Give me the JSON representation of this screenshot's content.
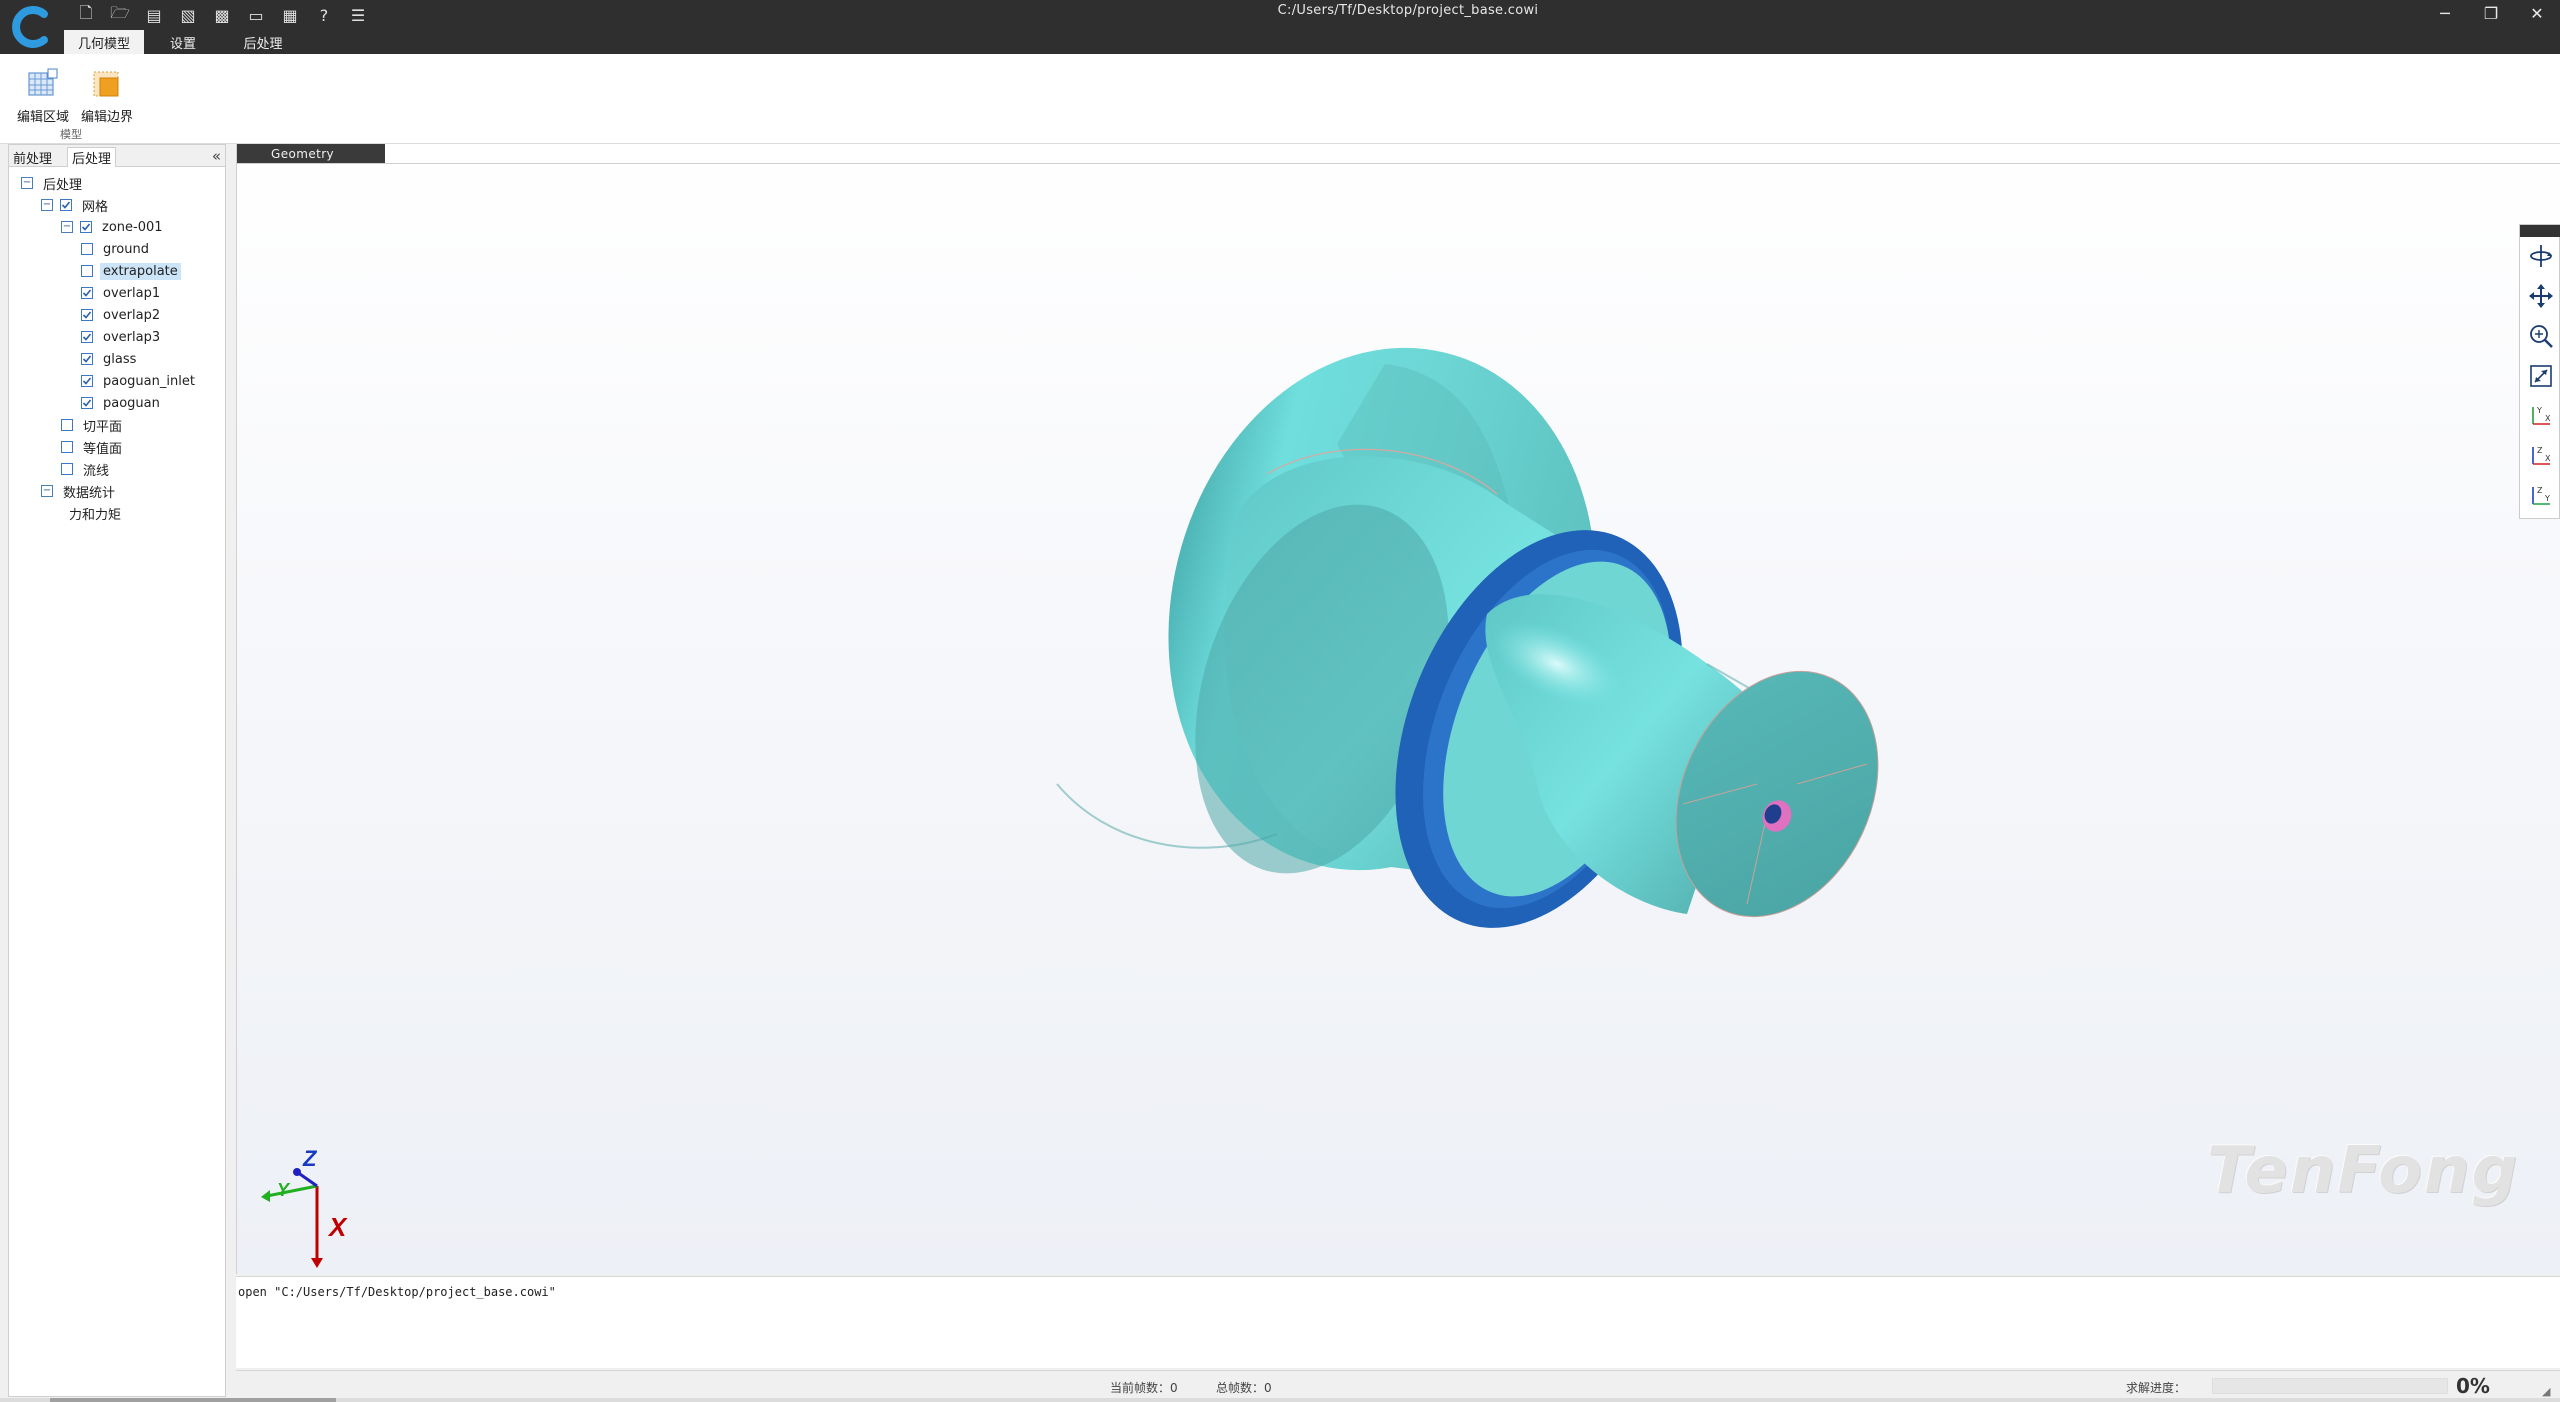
{
  "window": {
    "title": "C:/Users/Tf/Desktop/project_base.cowi",
    "minimize_glyph": "─",
    "restore_glyph": "❐",
    "close_glyph": "✕"
  },
  "quick_access": [
    {
      "name": "new-file-icon",
      "glyph": "🗋"
    },
    {
      "name": "open-folder-icon",
      "glyph": "🗁"
    },
    {
      "name": "import-icon",
      "glyph": "▤"
    },
    {
      "name": "export-icon",
      "glyph": "▧"
    },
    {
      "name": "run-script-icon",
      "glyph": "▩"
    },
    {
      "name": "save-icon",
      "glyph": "▭"
    },
    {
      "name": "save-as-icon",
      "glyph": "▦"
    },
    {
      "name": "help-icon",
      "glyph": "?"
    },
    {
      "name": "document-icon",
      "glyph": "☰"
    }
  ],
  "menu": {
    "tabs": [
      "几何模型",
      "设置",
      "后处理"
    ],
    "active_index": 0
  },
  "ribbon": {
    "buttons": [
      {
        "label": "编辑区域",
        "icon": "edit-region-icon"
      },
      {
        "label": "编辑边界",
        "icon": "edit-boundary-icon"
      }
    ],
    "group_label": "模型"
  },
  "left_panel": {
    "tabs": [
      "前处理",
      "后处理"
    ],
    "active_tab": 1,
    "collapse_glyph": "«",
    "tree": [
      {
        "label": "后处理",
        "level": 0,
        "expander": "−",
        "checkbox": null
      },
      {
        "label": "网格",
        "level": 1,
        "expander": "−",
        "checkbox": true
      },
      {
        "label": "zone-001",
        "level": 2,
        "expander": "−",
        "checkbox": true
      },
      {
        "label": "ground",
        "level": 3,
        "expander": null,
        "checkbox": false
      },
      {
        "label": "extrapolate",
        "level": 3,
        "expander": null,
        "checkbox": false,
        "selected": true
      },
      {
        "label": "overlap1",
        "level": 3,
        "expander": null,
        "checkbox": true
      },
      {
        "label": "overlap2",
        "level": 3,
        "expander": null,
        "checkbox": true
      },
      {
        "label": "overlap3",
        "level": 3,
        "expander": null,
        "checkbox": true
      },
      {
        "label": "glass",
        "level": 3,
        "expander": null,
        "checkbox": true
      },
      {
        "label": "paoguan_inlet",
        "level": 3,
        "expander": null,
        "checkbox": true
      },
      {
        "label": "paoguan",
        "level": 3,
        "expander": null,
        "checkbox": true
      },
      {
        "label": "切平面",
        "level": 2,
        "expander": null,
        "checkbox": false
      },
      {
        "label": "等值面",
        "level": 2,
        "expander": null,
        "checkbox": false
      },
      {
        "label": "流线",
        "level": 2,
        "expander": null,
        "checkbox": false
      },
      {
        "label": "数据统计",
        "level": 1,
        "expander": "−",
        "checkbox": null
      },
      {
        "label": "力和力矩",
        "level": 2,
        "expander": null,
        "checkbox": null
      }
    ]
  },
  "viewport": {
    "tab_label": "Geometry",
    "axes": {
      "z": "Z",
      "y": "Y",
      "x": "X"
    },
    "watermark": "TenFong",
    "colors": {
      "body": "#6fd6d4",
      "flange": "#1f62b8",
      "hole": "#e070c0"
    }
  },
  "view_toolbar": [
    {
      "name": "rotate-view-icon"
    },
    {
      "name": "pan-view-icon"
    },
    {
      "name": "zoom-view-icon"
    },
    {
      "name": "fit-view-icon"
    },
    {
      "name": "view-xy-icon"
    },
    {
      "name": "view-xz-icon"
    },
    {
      "name": "view-yz-icon"
    }
  ],
  "console": {
    "text": "open \"C:/Users/Tf/Desktop/project_base.cowi\""
  },
  "status": {
    "current_frame_label": "当前帧数：0",
    "total_frames_label": "总帧数：0",
    "progress_label": "求解进度：",
    "progress_value": 0,
    "progress_text": "0%"
  }
}
